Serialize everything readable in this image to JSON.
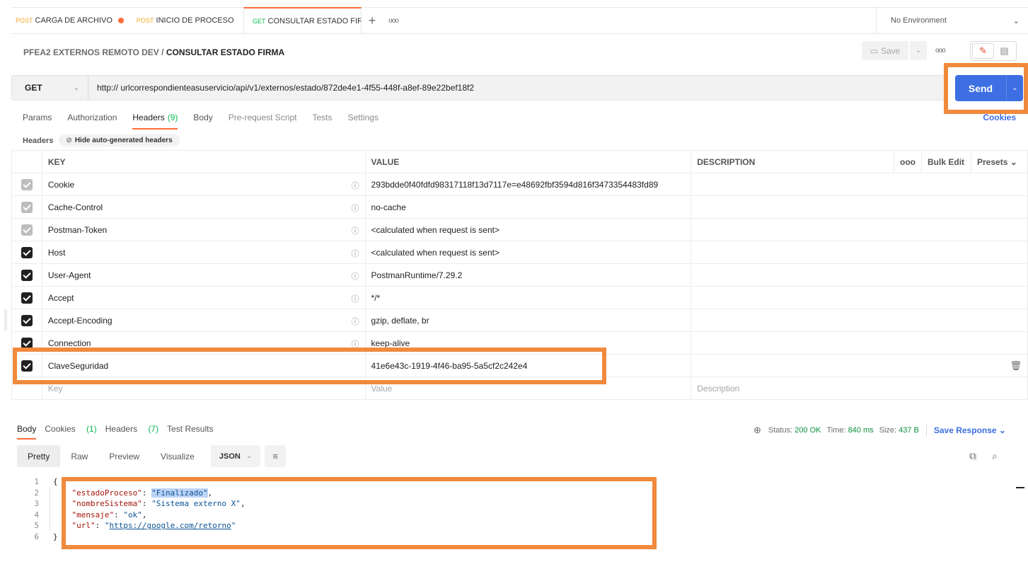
{
  "tabs": [
    {
      "method": "POST",
      "label": "CARGA DE ARCHIVO",
      "unsaved": true
    },
    {
      "method": "POST",
      "label": "INICIO DE PROCESO",
      "unsaved": false
    },
    {
      "method": "GET",
      "label": "CONSULTAR ESTADO FIR",
      "unsaved": false,
      "active": true
    }
  ],
  "tab_plus": "+",
  "tab_more": "ooo",
  "environment": {
    "label": "No Environment",
    "caret": "⌄"
  },
  "breadcrumb": {
    "collection": "PFEA2 EXTERNOS REMOTO DEV",
    "separator": "/",
    "request": "CONSULTAR ESTADO FIRMA"
  },
  "toolbar": {
    "save_label": "Save",
    "more": "ooo"
  },
  "request": {
    "method": "GET",
    "url": "http:// urlcorrespondienteasuservicio/api/v1/externos/estado/872de4e1-4f55-448f-a8ef-89e22bef18f2",
    "send_label": "Send"
  },
  "request_tabs": {
    "params": "Params",
    "authorization": "Authorization",
    "headers": "Headers",
    "headers_count": "(9)",
    "body": "Body",
    "prerequest": "Pre-request Script",
    "tests": "Tests",
    "settings": "Settings",
    "cookies": "Cookies"
  },
  "headers_section": {
    "label": "Headers",
    "hide_button": "Hide auto-generated headers"
  },
  "table": {
    "columns": {
      "key": "KEY",
      "value": "VALUE",
      "description": "DESCRIPTION",
      "more": "ooo",
      "bulk_edit": "Bulk Edit",
      "presets": "Presets"
    },
    "rows": [
      {
        "key": "Cookie",
        "value": "293bdde0f40fdfd98317118f13d7117e=e48692fbf3594d816f3473354483fd89",
        "auto": true
      },
      {
        "key": "Cache-Control",
        "value": "no-cache",
        "auto": true
      },
      {
        "key": "Postman-Token",
        "value": "<calculated when request is sent>",
        "auto": true
      },
      {
        "key": "Host",
        "value": "<calculated when request is sent>",
        "auto": false
      },
      {
        "key": "User-Agent",
        "value": "PostmanRuntime/7.29.2",
        "auto": false
      },
      {
        "key": "Accept",
        "value": "*/*",
        "auto": false
      },
      {
        "key": "Accept-Encoding",
        "value": "gzip, deflate, br",
        "auto": false
      },
      {
        "key": "Connection",
        "value": "keep-alive",
        "auto": false
      },
      {
        "key": "ClaveSeguridad",
        "value": "41e6e43c-1919-4f46-ba95-5a5cf2c242e4",
        "auto": false
      }
    ],
    "placeholders": {
      "key": "Key",
      "value": "Value",
      "description": "Description"
    }
  },
  "response": {
    "tabs": {
      "body": "Body",
      "cookies": "Cookies",
      "cookies_count": "(1)",
      "headers": "Headers",
      "headers_count": "(7)",
      "tests": "Test Results"
    },
    "status_label": "Status:",
    "status": "200 OK",
    "time_label": "Time:",
    "time": "840 ms",
    "size_label": "Size:",
    "size": "437 B",
    "save_response": "Save Response",
    "views": {
      "pretty": "Pretty",
      "raw": "Raw",
      "preview": "Preview",
      "visualize": "Visualize"
    },
    "format": "JSON",
    "body_lines": [
      {
        "n": "1",
        "text": "{"
      },
      {
        "n": "2",
        "key": "\"estadoProceso\"",
        "value": "\"Finalizado\"",
        "comma": ","
      },
      {
        "n": "3",
        "key": "\"nombreSistema\"",
        "value": "\"Sistema externo X\"",
        "comma": ","
      },
      {
        "n": "4",
        "key": "\"mensaje\"",
        "value": "\"ok\"",
        "comma": ","
      },
      {
        "n": "5",
        "key": "\"url\"",
        "value_q1": "\"",
        "value": "https://google.com/retorno",
        "value_q2": "\""
      },
      {
        "n": "6",
        "text": "}"
      }
    ]
  },
  "colors": {
    "accent": "#ff6c37",
    "send": "#3d6fe2",
    "highlight": "#f08a3c",
    "json_key": "#a3150a",
    "json_string": "#0b5394"
  }
}
